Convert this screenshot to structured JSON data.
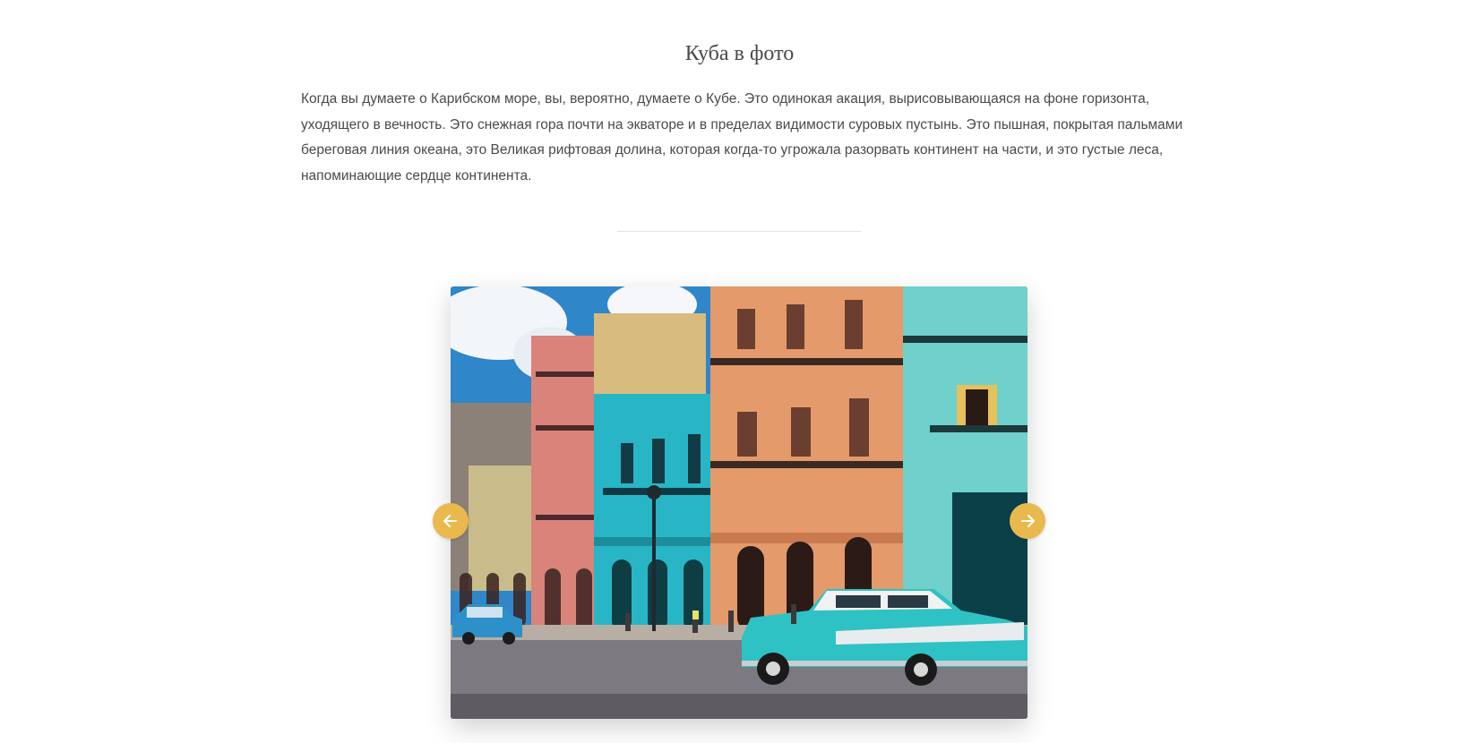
{
  "section": {
    "title": "Куба в фото",
    "intro": "Когда вы думаете о Карибском море, вы, вероятно, думаете о Кубе. Это одинокая акация, вырисовывающаяся на фоне горизонта, уходящего в вечность. Это снежная гора почти на экваторе и в пределах видимости суровых пустынь. Это пышная, покрытая пальмами береговая линия океана, это Великая рифтовая долина, которая когда-то угрожала разорвать континент на части, и это густые леса, напоминающие сердце континента."
  },
  "slider": {
    "prev_icon": "arrow-left-icon",
    "next_icon": "arrow-right-icon",
    "accent_color": "#e9b94d",
    "image_subject": "colorful colonial buildings with vintage cars"
  }
}
